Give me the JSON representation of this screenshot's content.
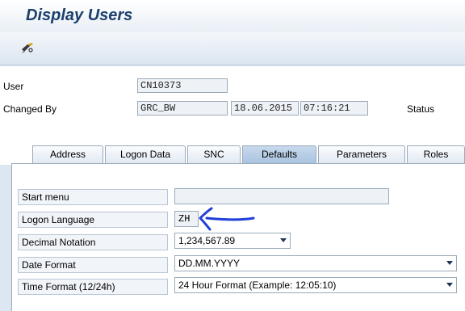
{
  "app": {
    "title": "Display Users"
  },
  "toolbar": {
    "icons": [
      "glasses-icon"
    ]
  },
  "header": {
    "user_label": "User",
    "user_value": "CN10373",
    "changed_by_label": "Changed By",
    "changed_by_value": "GRC_BW",
    "date_value": "18.06.2015",
    "time_value": "07:16:21",
    "status_label": "Status"
  },
  "tabs": [
    {
      "label": "Address"
    },
    {
      "label": "Logon Data"
    },
    {
      "label": "SNC"
    },
    {
      "label": "Defaults",
      "active": true
    },
    {
      "label": "Parameters"
    },
    {
      "label": "Roles"
    }
  ],
  "defaults": {
    "start_menu": {
      "label": "Start menu",
      "value": ""
    },
    "logon_language": {
      "label": "Logon Language",
      "value": "ZH"
    },
    "decimal_notation": {
      "label": "Decimal Notation",
      "value": "1,234,567.89"
    },
    "date_format": {
      "label": "Date Format",
      "value": "DD.MM.YYYY"
    },
    "time_format": {
      "label": "Time Format (12/24h)",
      "value": "24 Hour Format (Example: 12:05:10)"
    }
  },
  "annotation": {
    "type": "hand-drawn-arrow",
    "color": "#1f3fd8",
    "points_to": "logon_language"
  }
}
